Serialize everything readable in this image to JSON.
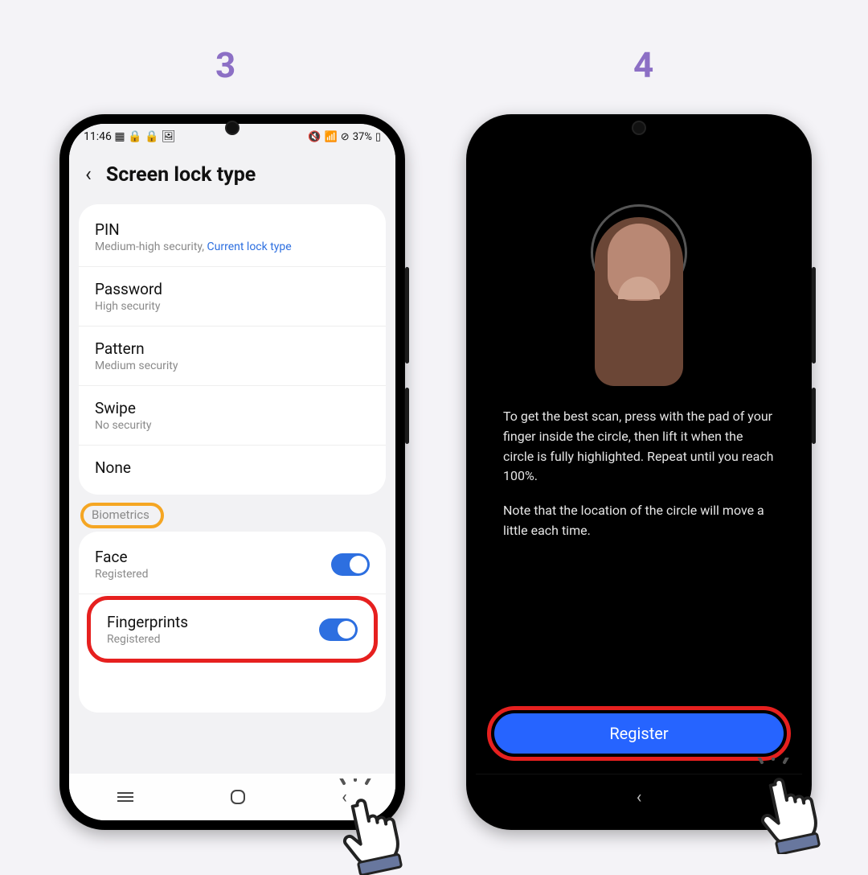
{
  "steps": {
    "left_label": "3",
    "right_label": "4"
  },
  "status": {
    "time": "11:46",
    "battery_text": "37%"
  },
  "header": {
    "title": "Screen lock type"
  },
  "lock_types": [
    {
      "title": "PIN",
      "subtitle_prefix": "Medium-high security, ",
      "subtitle_link": "Current lock type"
    },
    {
      "title": "Password",
      "subtitle": "High security"
    },
    {
      "title": "Pattern",
      "subtitle": "Medium security"
    },
    {
      "title": "Swipe",
      "subtitle": "No security"
    },
    {
      "title": "None",
      "subtitle": ""
    }
  ],
  "biometrics_label": "Biometrics",
  "biometrics": [
    {
      "title": "Face",
      "subtitle": "Registered",
      "enabled": true
    },
    {
      "title": "Fingerprints",
      "subtitle": "Registered",
      "enabled": true
    }
  ],
  "fp_screen": {
    "para1": "To get the best scan, press with the pad of your finger inside the circle, then lift it when the circle is fully highlighted. Repeat until you reach 100%.",
    "para2": "Note that the location of the circle will move a little each time.",
    "button": "Register"
  }
}
